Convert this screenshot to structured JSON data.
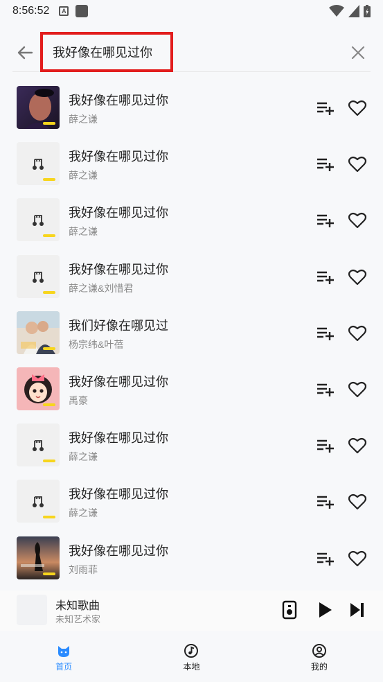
{
  "status_bar": {
    "time": "8:56:52"
  },
  "search": {
    "query": "我好像在哪见过你"
  },
  "songs": [
    {
      "title": "我好像在哪见过你",
      "artist": "薛之谦",
      "cover": "photo-dark"
    },
    {
      "title": "我好像在哪见过你",
      "artist": "薛之谦",
      "cover": "placeholder"
    },
    {
      "title": "我好像在哪见过你",
      "artist": "薛之谦",
      "cover": "placeholder"
    },
    {
      "title": "我好像在哪见过你",
      "artist": "薛之谦&刘惜君",
      "cover": "placeholder"
    },
    {
      "title": "我们好像在哪见过",
      "artist": "杨宗纬&叶蓓",
      "cover": "photo-couple"
    },
    {
      "title": "我好像在哪见过你",
      "artist": "禹豪",
      "cover": "photo-cartoon"
    },
    {
      "title": "我好像在哪见过你",
      "artist": "薛之谦",
      "cover": "placeholder"
    },
    {
      "title": "我好像在哪见过你",
      "artist": "薛之谦",
      "cover": "placeholder"
    },
    {
      "title": "我好像在哪见过你",
      "artist": "刘雨菲",
      "cover": "photo-sunset"
    }
  ],
  "player": {
    "title": "未知歌曲",
    "artist": "未知艺术家"
  },
  "tabs": [
    {
      "label": "首页",
      "active": true
    },
    {
      "label": "本地",
      "active": false
    },
    {
      "label": "我的",
      "active": false
    }
  ],
  "colors": {
    "accent": "#2a8bff",
    "highlight": "#e21d1d",
    "badge": "#f7d51d"
  }
}
